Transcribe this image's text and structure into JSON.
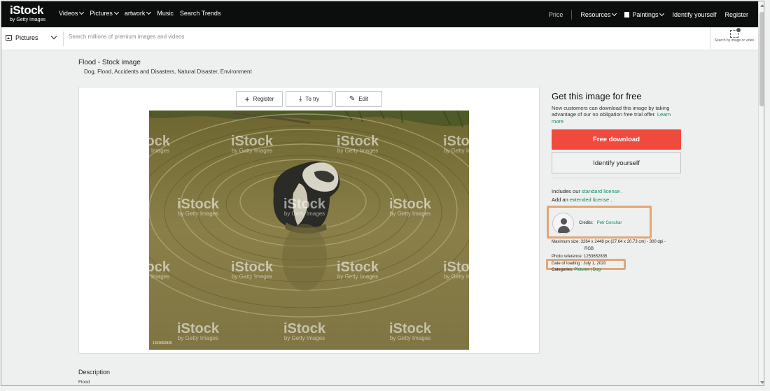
{
  "nav": {
    "logo": "iStock",
    "logo_sub": "by Getty Images",
    "left_items": [
      {
        "label": "Videos",
        "dropdown": true
      },
      {
        "label": "Pictures",
        "dropdown": true
      },
      {
        "label": "artwork",
        "dropdown": true
      },
      {
        "label": "Music",
        "dropdown": false
      },
      {
        "label": "Search Trends",
        "dropdown": false
      }
    ],
    "price": "Price",
    "resources": "Resources",
    "paintings": "Paintings",
    "identify": "Identify yourself",
    "register": "Register"
  },
  "search": {
    "media_type": "Pictures",
    "placeholder": "Search millions of premium images and videos",
    "by_image_label": "Search by image or video"
  },
  "page": {
    "title": "Flood - Stock image",
    "tags": "Dog, Flood, Accidents and Disasters, Natural Disaster, Environment"
  },
  "actions": {
    "register": "Register",
    "try": "To try",
    "edit": "Edit"
  },
  "watermark": {
    "brand": "iStock",
    "sub": "by Getty Images",
    "image_id": "1253652835"
  },
  "sidebar": {
    "heading": "Get this image for free",
    "desc_text": "New customers can download this image by taking advantage of our no obligation free trial offer. ",
    "desc_link": "Learn more",
    "free_download": "Free download",
    "identify": "Identify yourself",
    "license1_pre": "Includes our ",
    "license1_link": "standard license",
    "license1_post": " .",
    "license2_pre": "Add an ",
    "license2_link": "extended license",
    "license2_post": " .",
    "credits_label": "Credits:",
    "credits_name": "Petr Gonchar",
    "max_size": "Maximum size: 3264 x 2448 px (27.64 x 20.73 cm) - 300 dpi -",
    "color": "RGB",
    "photo_ref": "Photo reference:  1253652835",
    "date_loading": "Date of loading : July 1, 2020",
    "categories_label": "Categories: ",
    "categories_links": "Pictures | Dog"
  },
  "description": {
    "title": "Description",
    "text": "Flood"
  },
  "colors": {
    "accent": "#0a8a61",
    "cta": "#f04a3e",
    "highlight": "#e0a778",
    "nav_bg": "#0c0d0d"
  }
}
